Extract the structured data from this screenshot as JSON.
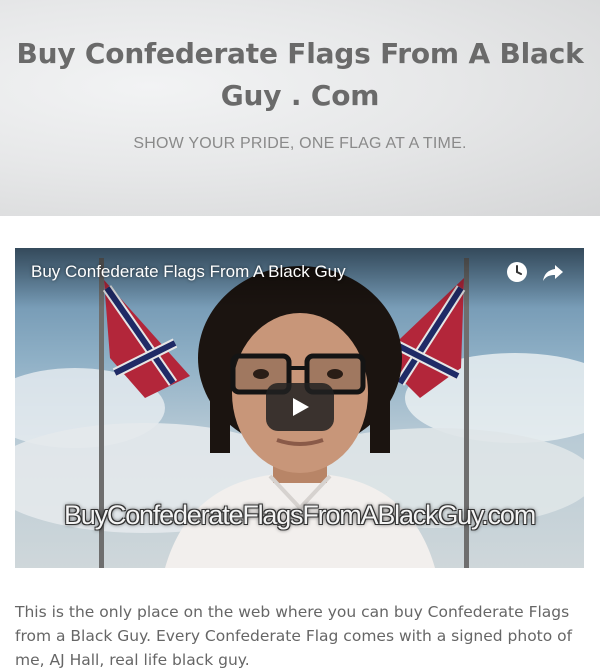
{
  "header": {
    "title": "Buy Confederate Flags From A Black Guy . Com",
    "tagline": "SHOW YOUR PRIDE, ONE FLAG AT A TIME."
  },
  "video": {
    "title": "Buy Confederate Flags From A Black Guy",
    "watermark": "BuyConfederateFlagsFromABlackGuy.com",
    "icons": [
      "clock-icon",
      "share-icon",
      "play-icon"
    ]
  },
  "content": {
    "paragraph": "This is the only place on the web where you can buy Confederate Flags from a Black Guy. Every Confederate Flag comes with a signed photo of me, AJ Hall, real life black guy."
  }
}
